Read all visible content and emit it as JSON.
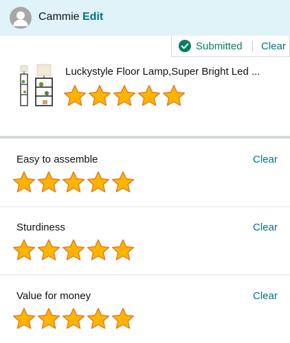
{
  "header": {
    "user_name": "Cammie",
    "edit_label": "Edit"
  },
  "status": {
    "text": "Submitted",
    "clear_label": "Clear"
  },
  "product": {
    "title": "Luckystyle Floor Lamp,Super Bright Led ...",
    "rating": 5,
    "max_rating": 5
  },
  "attributes": [
    {
      "label": "Easy to assemble",
      "clear_label": "Clear",
      "rating": 5,
      "max_rating": 5
    },
    {
      "label": "Sturdiness",
      "clear_label": "Clear",
      "rating": 5,
      "max_rating": 5
    },
    {
      "label": "Value for money",
      "clear_label": "Clear",
      "rating": 5,
      "max_rating": 5
    }
  ],
  "icons": {
    "avatar": "user-silhouette-icon",
    "status": "check-circle-icon",
    "star": "star-icon"
  },
  "colors": {
    "header_bg": "#dff3f8",
    "link": "#007185",
    "success": "#067d62",
    "star_fill": "#ffb400",
    "star_stroke": "#de7921"
  }
}
